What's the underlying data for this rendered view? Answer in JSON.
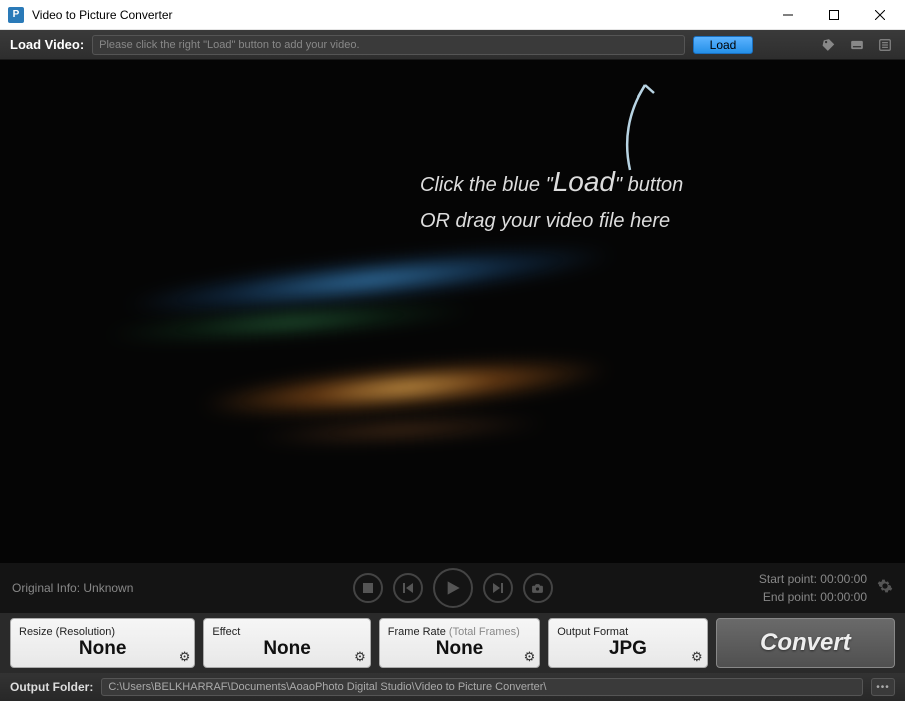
{
  "titlebar": {
    "title": "Video to Picture Converter"
  },
  "loadbar": {
    "label": "Load Video:",
    "placeholder": "Please click the right \"Load\" button to add your video.",
    "load_btn": "Load"
  },
  "preview": {
    "hint_line1_a": "Click the blue \"",
    "hint_line1_b": "Load",
    "hint_line1_c": "\" button",
    "hint_line2": "OR drag your video file here"
  },
  "player": {
    "info_label": "Original Info: Unknown",
    "start_label": "Start point: 00:00:00",
    "end_label": "End point: 00:00:00"
  },
  "settings": {
    "resize": {
      "label": "Resize (Resolution)",
      "value": "None"
    },
    "effect": {
      "label": "Effect",
      "value": "None"
    },
    "frame": {
      "label_a": "Frame Rate ",
      "label_b": "(Total Frames)",
      "value": "None"
    },
    "format": {
      "label": "Output Format",
      "value": "JPG"
    },
    "convert": "Convert"
  },
  "output": {
    "label": "Output Folder:",
    "path": "C:\\Users\\BELKHARRAF\\Documents\\AoaoPhoto Digital Studio\\Video to Picture Converter\\",
    "browse": "•••"
  }
}
